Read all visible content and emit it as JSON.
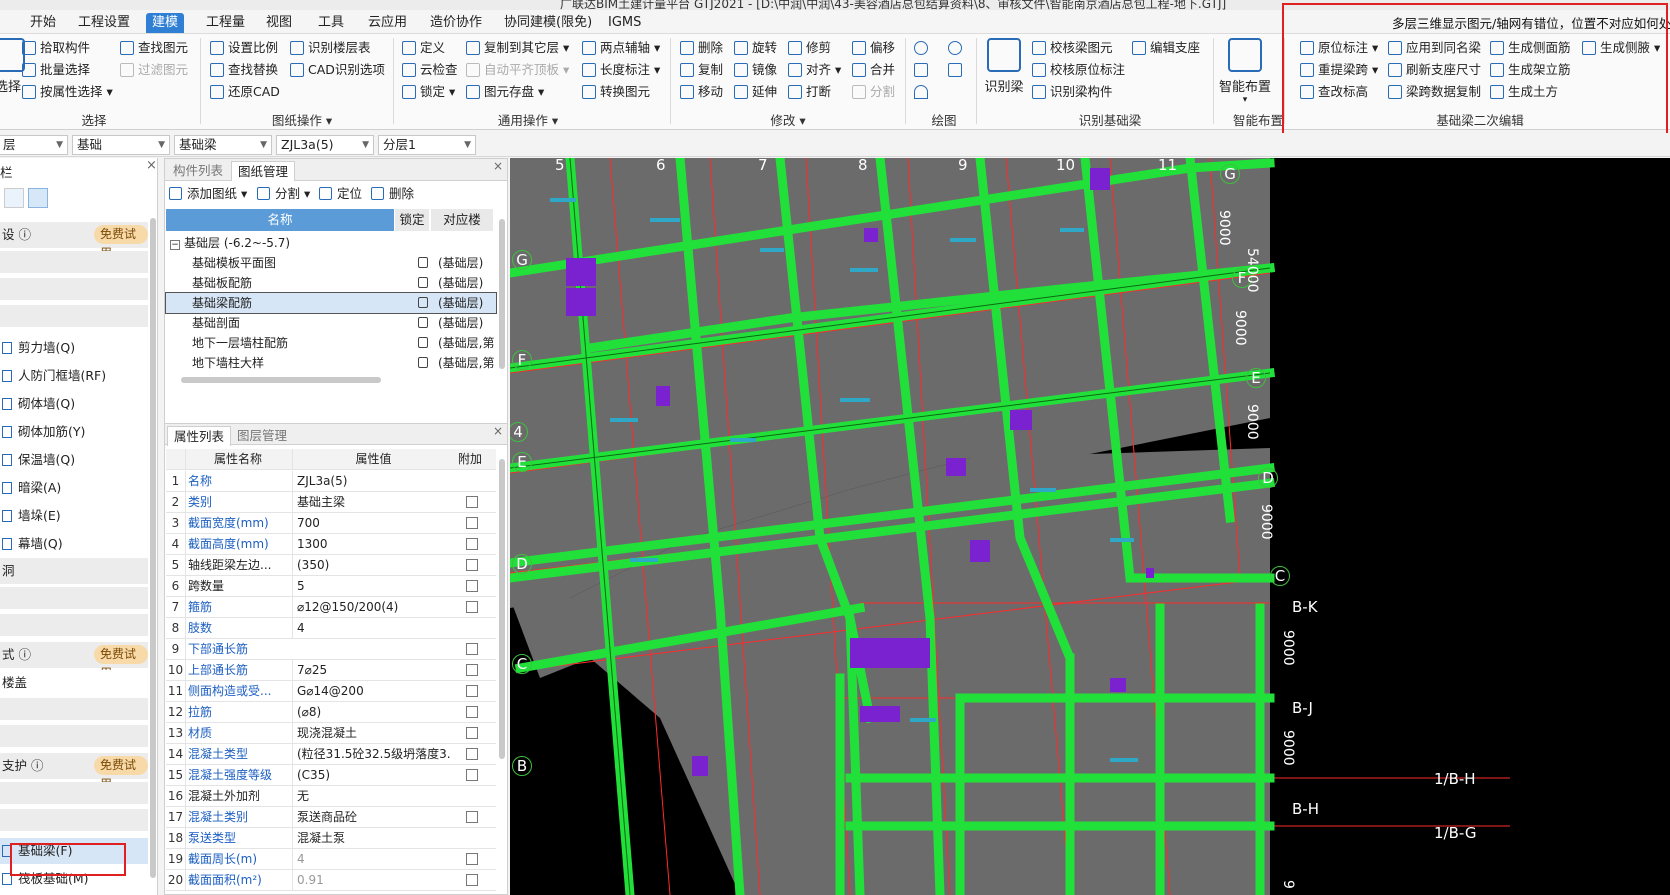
{
  "title_text": "广联达BIM土建计量平台 GTJ2021 - [D:\\中润\\中润\\43-美容酒店总包结算资料\\8、审核文件\\智能南京酒店总包工程-地下.GTJ]",
  "menu": [
    "开始",
    "工程设置",
    "建模",
    "工程量",
    "视图",
    "工具",
    "云应用",
    "造价协作",
    "协同建模(限免)",
    "IGMS"
  ],
  "ribbon": {
    "select": {
      "items": [
        "拾取构件",
        "批量选择",
        "按属性选择",
        "查找图元",
        "过滤图元"
      ],
      "big": "选择",
      "group": "选择"
    },
    "drawing_ops": {
      "items": [
        "设置比例",
        "查找替换",
        "还原CAD",
        "识别楼层表",
        "CAD识别选项"
      ],
      "group": "图纸操作"
    },
    "general_ops": {
      "items": [
        "定义",
        "云检查",
        "锁定",
        "复制到其它层",
        "自动平齐顶板",
        "图元存盘",
        "两点辅轴",
        "长度标注",
        "转换图元"
      ],
      "group": "通用操作"
    },
    "modify": {
      "items": [
        "删除",
        "复制",
        "移动",
        "旋转",
        "镜像",
        "延伸",
        "修剪",
        "对齐",
        "打断",
        "偏移",
        "合并",
        "分割"
      ],
      "group": "修改"
    },
    "draw": {
      "group": "绘图"
    },
    "identify_beam": {
      "big": "识别梁",
      "items": [
        "校核梁图元",
        "校核原位标注",
        "识别梁构件",
        "编辑支座"
      ],
      "group": "识别基础梁"
    },
    "smart_layout": {
      "big": "智能布置",
      "group": "智能布置"
    },
    "secondary_edit": {
      "items": [
        "原位标注",
        "重提梁跨",
        "查改标高",
        "应用到同名梁",
        "刷新支座尺寸",
        "梁跨数据复制",
        "生成侧面筋",
        "生成架立筋",
        "生成土方",
        "生成侧腋"
      ],
      "group": "基础梁二次编辑"
    }
  },
  "hint_text": "多层三维显示图元/轴网有错位，位置不对应如何处理",
  "selectors": [
    "层",
    "基础",
    "基础梁",
    "ZJL3a(5)",
    "分层1"
  ],
  "left_panel": {
    "title": "栏",
    "sections": [
      {
        "label": "设",
        "badge": "免费试用"
      },
      {
        "label": "式",
        "badge": "免费试用"
      },
      {
        "label": "支护",
        "badge": "免费试用"
      }
    ],
    "items": [
      "剪力墙(Q)",
      "人防门框墙(RF)",
      "砌体墙(Q)",
      "砌体加筋(Y)",
      "保温墙(Q)",
      "暗梁(A)",
      "墙垛(E)",
      "幕墙(Q)"
    ],
    "misc": [
      "洞",
      "楼盖"
    ],
    "bottom_items": [
      "基础梁(F)",
      "筏板基础(M)"
    ]
  },
  "drawing_panel": {
    "tabs": [
      "构件列表",
      "图纸管理"
    ],
    "toolbar": [
      "添加图纸",
      "分割",
      "定位",
      "删除"
    ],
    "columns": [
      "名称",
      "锁定",
      "对应楼"
    ],
    "group": "基础层 (-6.2~-5.7)",
    "rows": [
      {
        "name": "基础模板平面图",
        "floor": "(基础层)"
      },
      {
        "name": "基础板配筋",
        "floor": "(基础层)"
      },
      {
        "name": "基础梁配筋",
        "floor": "(基础层)"
      },
      {
        "name": "基础剖面",
        "floor": "(基础层)"
      },
      {
        "name": "地下一层墙柱配筋",
        "floor": "(基础层,第"
      },
      {
        "name": "地下墙柱大样",
        "floor": "(基础层,第"
      }
    ]
  },
  "prop_panel": {
    "tabs": [
      "属性列表",
      "图层管理"
    ],
    "columns": [
      "属性名称",
      "属性值",
      "附加"
    ],
    "rows": [
      {
        "n": "1",
        "k": "名称",
        "v": "ZJL3a(5)",
        "blue": true,
        "cb": false
      },
      {
        "n": "2",
        "k": "类别",
        "v": "基础主梁",
        "blue": true,
        "cb": true
      },
      {
        "n": "3",
        "k": "截面宽度(mm)",
        "v": "700",
        "blue": true,
        "cb": true
      },
      {
        "n": "4",
        "k": "截面高度(mm)",
        "v": "1300",
        "blue": true,
        "cb": true
      },
      {
        "n": "5",
        "k": "轴线距梁左边...",
        "v": "(350)",
        "blue": false,
        "cb": true
      },
      {
        "n": "6",
        "k": "跨数量",
        "v": "5",
        "blue": false,
        "cb": true
      },
      {
        "n": "7",
        "k": "箍筋",
        "v": "⌀12@150/200(4)",
        "blue": true,
        "cb": true
      },
      {
        "n": "8",
        "k": "肢数",
        "v": "4",
        "blue": true,
        "cb": false
      },
      {
        "n": "9",
        "k": "下部通长筋",
        "v": "",
        "blue": true,
        "cb": true
      },
      {
        "n": "10",
        "k": "上部通长筋",
        "v": "7⌀25",
        "blue": true,
        "cb": true
      },
      {
        "n": "11",
        "k": "侧面构造或受...",
        "v": "G⌀14@200",
        "blue": true,
        "cb": true
      },
      {
        "n": "12",
        "k": "拉筋",
        "v": "(⌀8)",
        "blue": true,
        "cb": true
      },
      {
        "n": "13",
        "k": "材质",
        "v": "现浇混凝土",
        "blue": true,
        "cb": true
      },
      {
        "n": "14",
        "k": "混凝土类型",
        "v": "(粒径31.5砼32.5级坍落度3...",
        "blue": true,
        "cb": true
      },
      {
        "n": "15",
        "k": "混凝土强度等级",
        "v": "(C35)",
        "blue": true,
        "cb": true
      },
      {
        "n": "16",
        "k": "混凝土外加剂",
        "v": "无",
        "blue": false,
        "cb": false
      },
      {
        "n": "17",
        "k": "混凝土类别",
        "v": "泵送商品砼",
        "blue": true,
        "cb": true
      },
      {
        "n": "18",
        "k": "泵送类型",
        "v": "混凝土泵",
        "blue": true,
        "cb": false
      },
      {
        "n": "19",
        "k": "截面周长(m)",
        "v": "4",
        "blue": true,
        "cb": true,
        "grey": true
      },
      {
        "n": "20",
        "k": "截面面积(m²)",
        "v": "0.91",
        "blue": true,
        "cb": true,
        "grey": true
      }
    ]
  },
  "canvas": {
    "top_axes": [
      "5",
      "6",
      "7",
      "8",
      "9",
      "10",
      "11"
    ],
    "right_axes": [
      "G",
      "F",
      "E",
      "D",
      "C",
      "B-K",
      "B-J",
      "1/B-H",
      "B-H",
      "1/B-G"
    ],
    "left_axes": [
      "G",
      "F",
      "4",
      "E",
      "D",
      "C",
      "B"
    ],
    "dims": [
      "9000",
      "54000",
      "9000",
      "9000",
      "9000",
      "9000",
      "9000",
      "9"
    ]
  },
  "colors": {
    "accent": "#2f7fd4",
    "beam": "#22e03a",
    "slab": "#6b6b6b",
    "column": "#7a22d0",
    "highlight": "#e02020"
  }
}
